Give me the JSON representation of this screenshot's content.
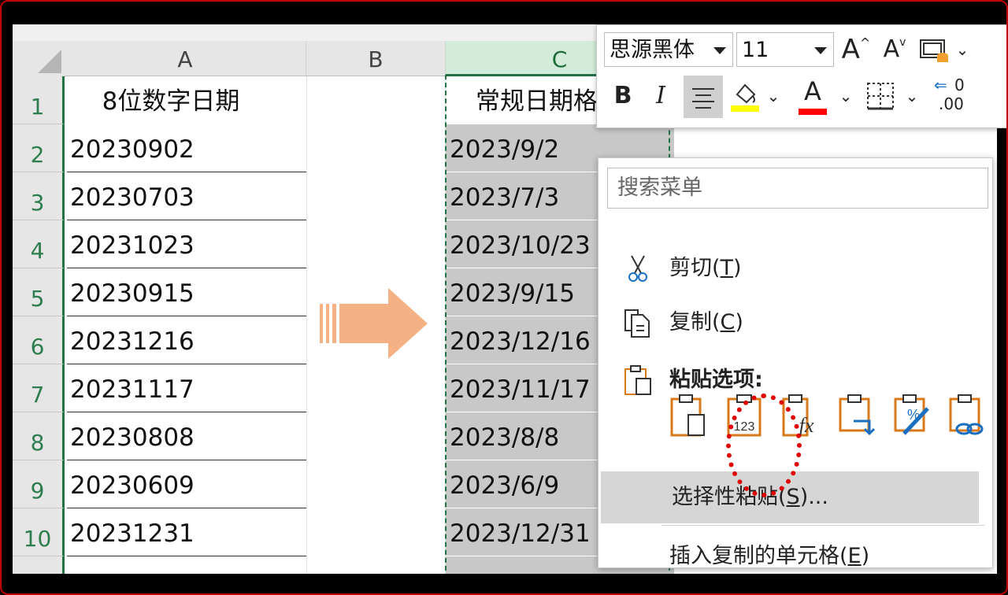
{
  "columns": {
    "a": "A",
    "b": "B",
    "c": "C"
  },
  "rows": [
    "1",
    "2",
    "3",
    "4",
    "5",
    "6",
    "7",
    "8",
    "9",
    "10"
  ],
  "col_a": {
    "header": "8位数字日期",
    "values": [
      "20230902",
      "20230703",
      "20231023",
      "20230915",
      "20231216",
      "20231117",
      "20230808",
      "20230609",
      "20231231"
    ]
  },
  "col_c": {
    "header": "常规日期格",
    "values": [
      "2023/9/2",
      "2023/7/3",
      "2023/10/23",
      "2023/9/15",
      "2023/12/16",
      "2023/11/17",
      "2023/8/8",
      "2023/6/9",
      "2023/12/31"
    ]
  },
  "toolbar": {
    "font_name": "思源黑体",
    "font_size": "11",
    "grow_label": "A",
    "shrink_label": "A",
    "bold_label": "B",
    "italic_label": "I",
    "font_color_label": "A",
    "highlight_color": "#ffff00",
    "font_color": "#ff0000",
    "decimal_label": ".00"
  },
  "menu": {
    "search_placeholder": "搜索菜单",
    "cut": "剪切(",
    "cut_key": "T",
    "copy": "复制(",
    "copy_key": "C",
    "paste_options": "粘贴选项:",
    "paste_values_label": "123",
    "paste_formula_label": "fx",
    "paste_special": "选择性粘贴(",
    "paste_special_key": "S",
    "paste_special_suffix": ")...",
    "insert_copied": "插入复制的单元格(",
    "insert_key": "E",
    "close_paren": ")"
  },
  "colors": {
    "accent": "#217346",
    "paste_icon": "#d97a1a",
    "arrow": "#f4b183",
    "annotation": "#e00000"
  }
}
